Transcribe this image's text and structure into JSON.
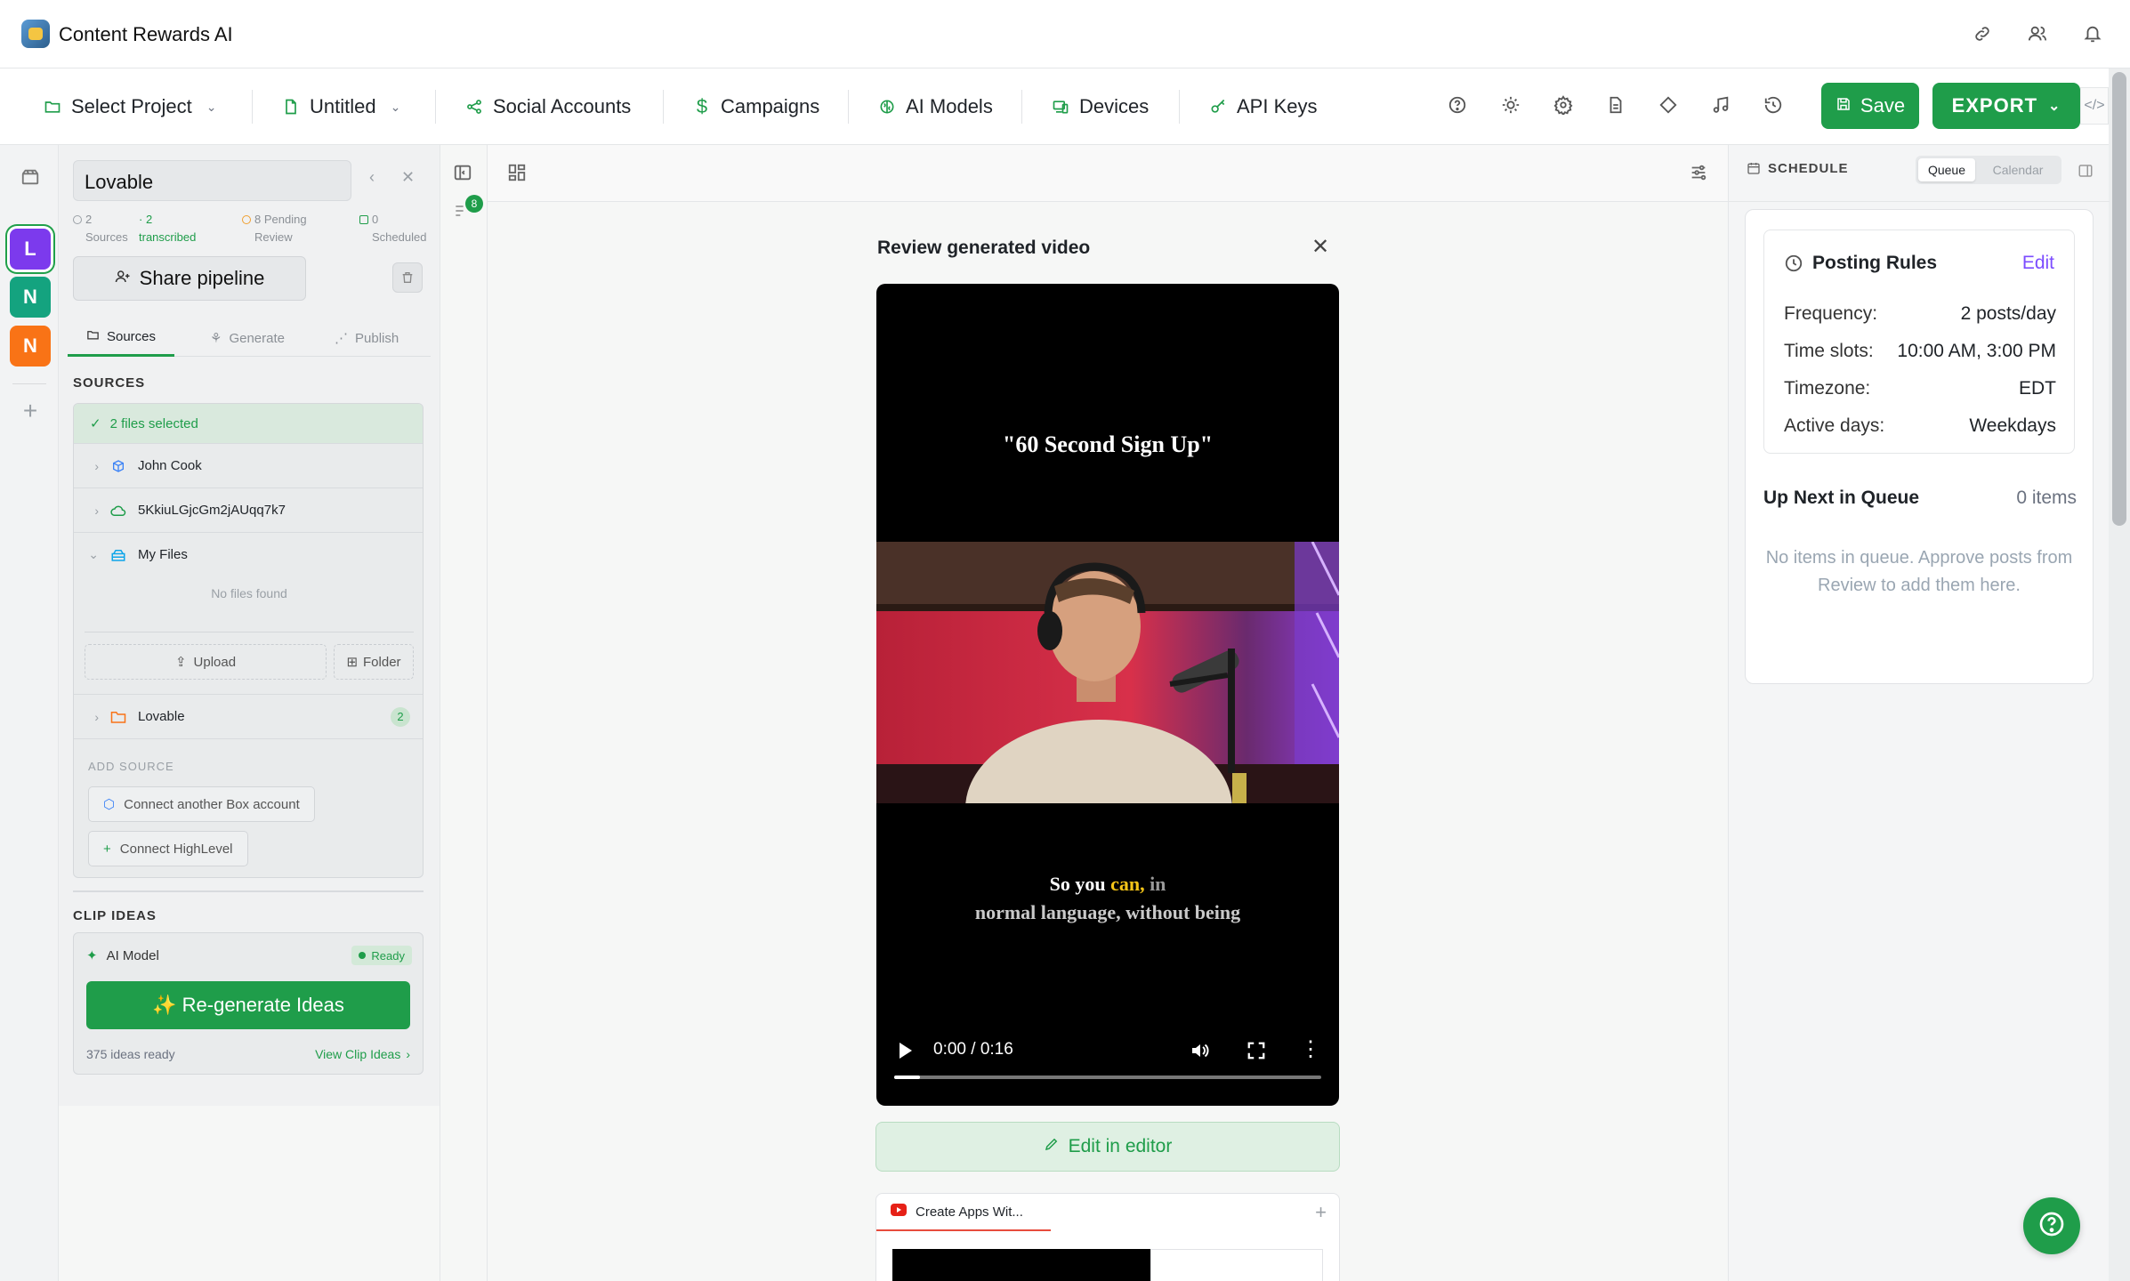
{
  "app": {
    "title": "Content Rewards AI"
  },
  "toolbar": {
    "select_project": "Select Project",
    "untitled": "Untitled",
    "social_accounts": "Social Accounts",
    "campaigns": "Campaigns",
    "ai_models": "AI Models",
    "devices": "Devices",
    "api_keys": "API Keys",
    "save": "Save",
    "export": "EXPORT"
  },
  "rail": {
    "workspaces": [
      {
        "initial": "L",
        "color": "#7c3aed"
      },
      {
        "initial": "N",
        "color": "#14a37f"
      },
      {
        "initial": "N",
        "color": "#f97316"
      }
    ],
    "badge_count": "8"
  },
  "left_panel": {
    "project_name": "Lovable",
    "stats": {
      "sources_count": "2",
      "sources_label": "Sources",
      "transcribed_count": "· 2",
      "transcribed_label": "transcribed",
      "pending_count": "8 Pending",
      "pending_label": "Review",
      "scheduled_count": "0",
      "scheduled_label": "Scheduled"
    },
    "share_button": "Share pipeline",
    "tabs": [
      "Sources",
      "Generate",
      "Publish"
    ],
    "sources_heading": "SOURCES",
    "selected_text": "2 files selected",
    "sources": [
      {
        "name": "John Cook",
        "icon": "box-icon"
      },
      {
        "name": "5KkiuLGjcGm2jAUqq7k7",
        "icon": "cloud-icon"
      },
      {
        "name": "My Files",
        "icon": "drive-icon"
      }
    ],
    "no_files": "No files found",
    "upload": "Upload",
    "folder": "Folder",
    "lovable_folder": {
      "name": "Lovable",
      "count": "2"
    },
    "add_source_label": "ADD SOURCE",
    "connect_box": "Connect another Box account",
    "connect_highlevel": "Connect HighLevel",
    "clip_ideas_heading": "CLIP IDEAS",
    "ai_model_label": "AI Model",
    "ready": "Ready",
    "regenerate": "✨ Re-generate Ideas",
    "ideas_ready": "375 ideas ready",
    "view_clip_ideas": "View Clip Ideas"
  },
  "review": {
    "title": "Review generated video",
    "video_title": "\"60 Second Sign Up\"",
    "caption_line1": {
      "part1": "So you ",
      "highlight": "can,",
      "part2": " in"
    },
    "caption_line2": "normal language, without being",
    "timecode": "0:00 / 0:16",
    "progress": 0.06,
    "edit_button": "Edit in editor",
    "yt_tab": "Create Apps Wit..."
  },
  "schedule": {
    "label": "SCHEDULE",
    "segments": [
      "Queue",
      "Calendar"
    ],
    "posting_rules_title": "Posting Rules",
    "edit": "Edit",
    "rules": [
      {
        "key": "Frequency:",
        "value": "2 posts/day"
      },
      {
        "key": "Time slots:",
        "value": "10:00 AM, 3:00 PM"
      },
      {
        "key": "Timezone:",
        "value": "EDT"
      },
      {
        "key": "Active days:",
        "value": "Weekdays"
      }
    ],
    "queue_title": "Up Next in Queue",
    "queue_count": "0 items",
    "queue_empty": "No items in queue. Approve posts from Review to add them here."
  },
  "colors": {
    "accent": "#1f9d4a",
    "edit_link": "#7c4dff"
  }
}
